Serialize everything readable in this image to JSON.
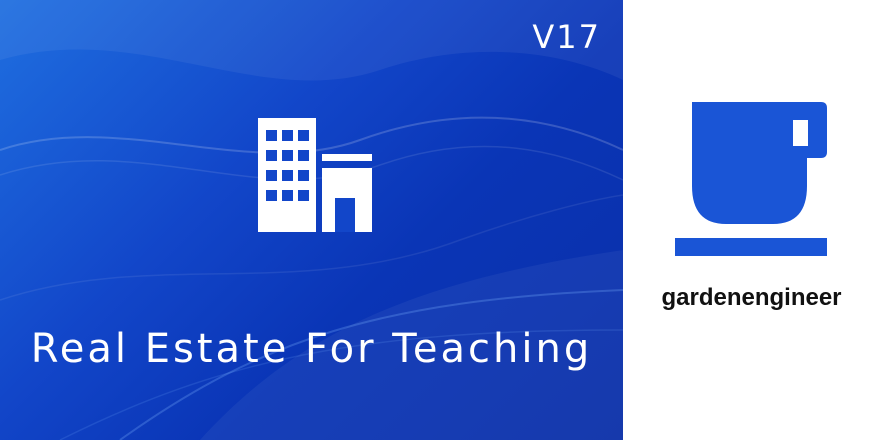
{
  "banner": {
    "version": "V17",
    "title": "Real Estate For Teaching",
    "icon": "office-building-icon",
    "colors": {
      "gradient_light": "#1f6fe0",
      "gradient_dark": "#0a2fa8",
      "text": "#ffffff"
    }
  },
  "sidebar": {
    "icon": "coffee-cup-icon",
    "author": "gardenengineer",
    "colors": {
      "icon": "#1a55d6",
      "text": "#111111",
      "background": "#ffffff"
    }
  }
}
